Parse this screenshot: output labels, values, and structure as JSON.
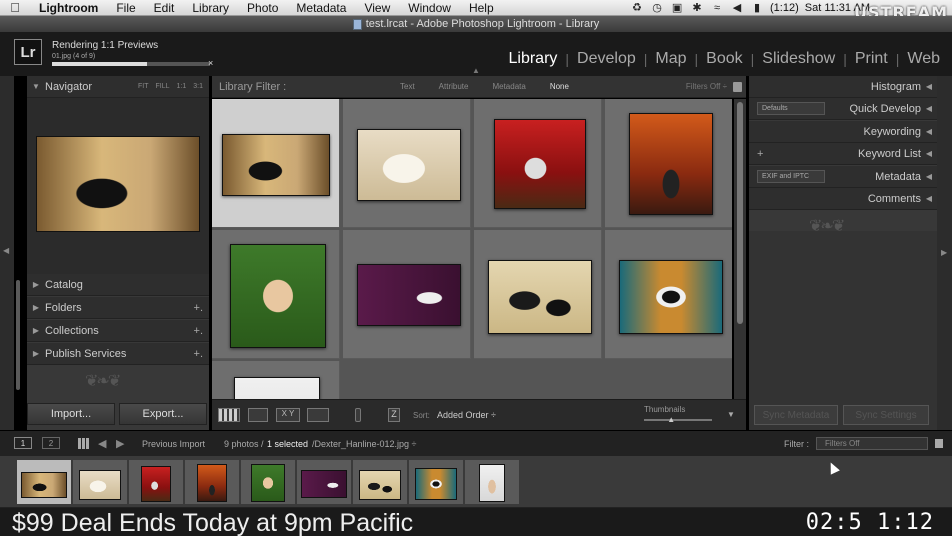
{
  "menubar": {
    "items": [
      "Lightroom",
      "File",
      "Edit",
      "Library",
      "Photo",
      "Metadata",
      "View",
      "Window",
      "Help"
    ],
    "battery": "(1:12)",
    "clock": "Sat 11:31 AM",
    "stream_brand": "USTREAM"
  },
  "window": {
    "title": "test.lrcat - Adobe Photoshop Lightroom - Library"
  },
  "identity": {
    "logo": "Lr",
    "activity_title": "Rendering 1:1 Previews",
    "activity_sub": "01.jpg (4 of 9)",
    "progress_percent": 60,
    "close_glyph": "×"
  },
  "modules": [
    {
      "label": "Library",
      "active": true
    },
    {
      "label": "Develop",
      "active": false
    },
    {
      "label": "Map",
      "active": false
    },
    {
      "label": "Book",
      "active": false
    },
    {
      "label": "Slideshow",
      "active": false
    },
    {
      "label": "Print",
      "active": false
    },
    {
      "label": "Web",
      "active": false
    }
  ],
  "left_panel": {
    "navigator": {
      "title": "Navigator",
      "zoom_options": [
        "FIT",
        "FILL",
        "1:1",
        "3:1"
      ]
    },
    "sections": [
      {
        "label": "Catalog",
        "plus": false
      },
      {
        "label": "Folders",
        "plus": true
      },
      {
        "label": "Collections",
        "plus": true
      },
      {
        "label": "Publish Services",
        "plus": true
      }
    ],
    "import_label": "Import...",
    "export_label": "Export..."
  },
  "filter_bar": {
    "title": "Library Filter :",
    "options": [
      {
        "label": "Text",
        "active": false
      },
      {
        "label": "Attribute",
        "active": false
      },
      {
        "label": "Metadata",
        "active": false
      },
      {
        "label": "None",
        "active": true
      }
    ],
    "filters_off": "Filters Off ÷"
  },
  "grid": {
    "photos": [
      {
        "name": "cat-on-stairs",
        "style": "p-cat",
        "selected": true
      },
      {
        "name": "white-puppy",
        "style": "p-puppy-white",
        "selected": false
      },
      {
        "name": "kitten-red-chair",
        "style": "p-kitten-red",
        "selected": false
      },
      {
        "name": "dog-red-backdrop",
        "style": "p-dog-red",
        "selected": false
      },
      {
        "name": "family-grass",
        "style": "p-family",
        "selected": false
      },
      {
        "name": "puppy-purple-chair",
        "style": "p-puppy-purple",
        "selected": false
      },
      {
        "name": "dogs-cream-couch",
        "style": "p-dogs-cream",
        "selected": false
      },
      {
        "name": "dog-in-chair",
        "style": "p-dog-chair",
        "selected": false
      },
      {
        "name": "couple-partial",
        "style": "p-couple",
        "selected": false
      }
    ]
  },
  "toolbar": {
    "sort_label": "Sort:",
    "sort_value": "Added Order ÷",
    "thumbnails_label": "Thumbnails",
    "thumbnail_size_fraction": 0.4
  },
  "right_panel": {
    "rows": [
      {
        "label": "Histogram",
        "preset": "",
        "add": false
      },
      {
        "label": "Quick Develop",
        "preset": "Defaults",
        "add": false
      },
      {
        "label": "Keywording",
        "preset": "",
        "add": false
      },
      {
        "label": "Keyword List",
        "preset": "",
        "add": true
      },
      {
        "label": "Metadata",
        "preset": "EXIF and IPTC",
        "add": false
      },
      {
        "label": "Comments",
        "preset": "",
        "add": false
      }
    ],
    "sync_metadata": "Sync Metadata",
    "sync_settings": "Sync Settings"
  },
  "filmstrip_bar": {
    "screen_1": "1",
    "screen_2": "2",
    "previous_import": "Previous Import",
    "status_count": "9 photos /",
    "status_selected": "1 selected",
    "status_file": "/Dexter_Hanline-012.jpg ÷",
    "filter_label": "Filter :",
    "filter_value": "Filters Off"
  },
  "overlay": {
    "deal": "$99 Deal Ends Today at 9pm Pacific",
    "timer": "02:5 1:12"
  }
}
